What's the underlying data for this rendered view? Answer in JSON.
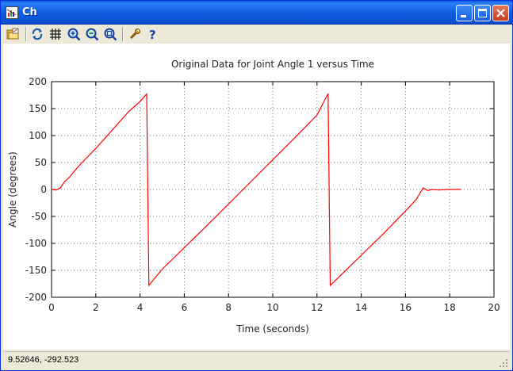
{
  "window": {
    "title": "Ch"
  },
  "toolbar": {
    "tools": [
      {
        "name": "open-icon"
      },
      {
        "name": "refresh-icon"
      },
      {
        "name": "grid-icon"
      },
      {
        "name": "zoom-in-icon"
      },
      {
        "name": "zoom-out-icon"
      },
      {
        "name": "zoom-fit-icon"
      },
      {
        "name": "properties-wrench-icon"
      },
      {
        "name": "help-icon"
      }
    ]
  },
  "status": {
    "text": "9.52646, -292.523"
  },
  "chart_data": {
    "type": "line",
    "title": "Original Data for Joint Angle 1 versus Time",
    "xlabel": "Time (seconds)",
    "ylabel": "Angle (degrees)",
    "xlim": [
      0,
      20
    ],
    "ylim": [
      -200,
      200
    ],
    "xticks": [
      0,
      2,
      4,
      6,
      8,
      10,
      12,
      14,
      16,
      18,
      20
    ],
    "yticks": [
      -200,
      -150,
      -100,
      -50,
      0,
      50,
      100,
      150,
      200
    ],
    "grid": true,
    "color": "#ff0000",
    "series": [
      {
        "x": [
          0,
          0.2,
          0.4,
          0.6,
          0.8,
          1.2,
          1.5,
          2.0,
          2.5,
          3.0,
          3.5,
          4.0,
          4.3,
          4.35,
          4.4,
          5.0,
          6.0,
          7.0,
          8.0,
          9.0,
          10.0,
          11.0,
          12.0,
          12.5,
          12.55,
          12.6,
          13.0,
          14.0,
          15.0,
          16.0,
          16.5,
          16.8,
          17.0,
          17.2,
          17.5,
          18.0,
          18.5
        ],
        "y": [
          0,
          -1,
          3,
          15,
          22,
          42,
          55,
          76,
          99,
          122,
          145,
          163,
          177,
          0,
          -178,
          -148,
          -108,
          -68,
          -27,
          14,
          55,
          96,
          138,
          178,
          0,
          -178,
          -162,
          -122,
          -82,
          -40,
          -18,
          3,
          -2,
          0,
          -1,
          0,
          0
        ]
      }
    ]
  }
}
